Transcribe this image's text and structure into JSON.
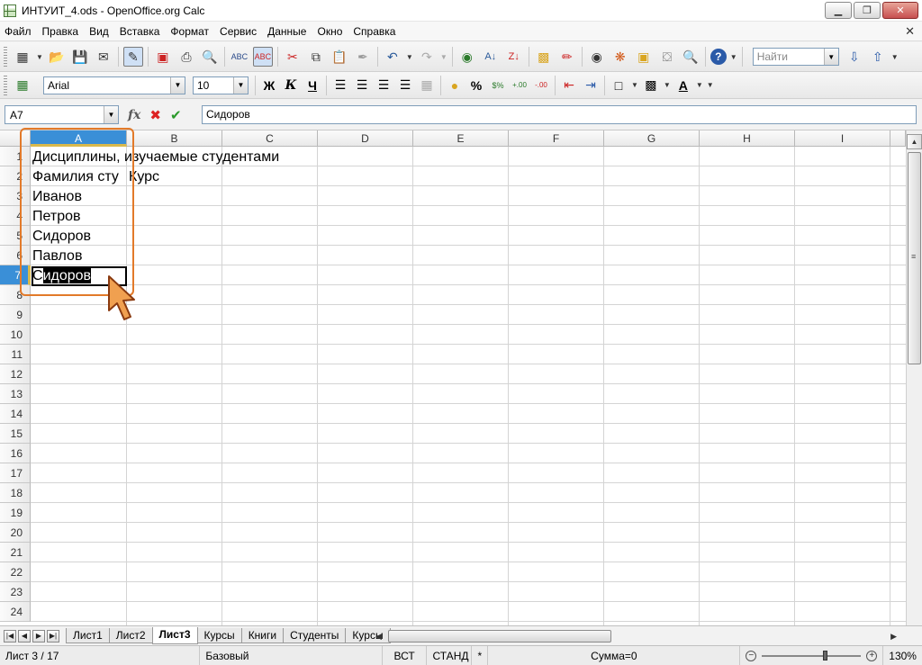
{
  "window": {
    "title": "ИНТУИТ_4.ods - OpenOffice.org Calc",
    "buttons": {
      "minimize": "▁",
      "maximize": "❐",
      "close": "✕"
    }
  },
  "menu": {
    "items": [
      "Файл",
      "Правка",
      "Вид",
      "Вставка",
      "Формат",
      "Сервис",
      "Данные",
      "Окно",
      "Справка"
    ],
    "close_doc": "✕"
  },
  "toolbar_standard": {
    "icons": [
      "new-icon",
      "open-icon",
      "save-icon",
      "email-icon",
      "edit-mode-icon",
      "export-pdf-icon",
      "print-icon",
      "page-preview-icon",
      "spellcheck-icon",
      "autospellcheck-icon",
      "cut-icon",
      "copy-icon",
      "paste-icon",
      "clone-format-icon",
      "undo-icon",
      "redo-icon",
      "hyperlink-icon",
      "sort-asc-icon",
      "sort-desc-icon",
      "chart-icon",
      "draw-icon",
      "navigator-icon",
      "gallery-icon",
      "datasources-icon",
      "zoom-icon",
      "help-icon"
    ],
    "find_placeholder": "Найти"
  },
  "toolbar_format": {
    "font_name": "Arial",
    "font_size": "10",
    "bold": "Ж",
    "italic": "К",
    "underline": "Ч",
    "percent": "%"
  },
  "formula_bar": {
    "name_box": "A7",
    "content": "Сидоров"
  },
  "columns": [
    "A",
    "B",
    "C",
    "D",
    "E",
    "F",
    "G",
    "H",
    "I"
  ],
  "selected_column": "A",
  "rows": [
    "1",
    "2",
    "3",
    "4",
    "5",
    "6",
    "7",
    "8",
    "9",
    "10",
    "11",
    "12",
    "13",
    "14",
    "15",
    "16",
    "17",
    "18",
    "19",
    "20",
    "21",
    "22",
    "23",
    "24"
  ],
  "selected_row": "7",
  "cells": {
    "a1": "Дисциплины, изучаемые студентами",
    "a2": "Фамилия сту",
    "b2": "Курс",
    "a3": "Иванов",
    "a4": "Петров",
    "a5": "Сидоров",
    "a6": "Павлов",
    "a7_typed": "С",
    "a7_autocomplete": "идоров"
  },
  "sheet_tabs": [
    "Лист1",
    "Лист2",
    "Лист3",
    "Курсы",
    "Книги",
    "Студенты",
    "Курсы"
  ],
  "current_sheet": "Лист3",
  "status": {
    "sheet": "Лист 3 / 17",
    "style": "Базовый",
    "insert_mode": "ВСТ",
    "selection_mode": "СТАНД",
    "modified": "*",
    "sum": "Сумма=0",
    "zoom": "130%"
  },
  "colors": {
    "selection_header": "#3a8fd7",
    "annotation": "#e27a2a"
  }
}
